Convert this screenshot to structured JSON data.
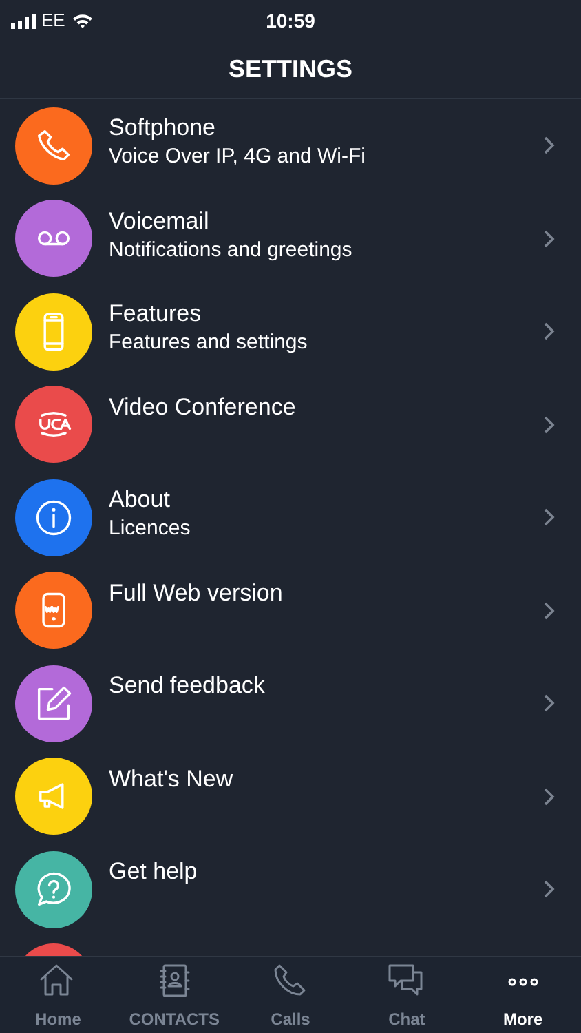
{
  "status_bar": {
    "carrier": "EE",
    "time": "10:59"
  },
  "header": {
    "title": "SETTINGS"
  },
  "items": [
    {
      "title": "Softphone",
      "subtitle": "Voice Over IP, 4G and Wi-Fi",
      "color": "#fb6a1e"
    },
    {
      "title": "Voicemail",
      "subtitle": "Notifications and greetings",
      "color": "#b36ad9"
    },
    {
      "title": "Features",
      "subtitle": "Features and settings",
      "color": "#fcd10f"
    },
    {
      "title": "Video Conference",
      "color": "#ea4b4b"
    },
    {
      "title": "About",
      "subtitle": "Licences",
      "color": "#1e72ee"
    },
    {
      "title": "Full Web version",
      "color": "#fb6a1e"
    },
    {
      "title": "Send feedback",
      "color": "#b36ad9"
    },
    {
      "title": "What's New",
      "color": "#fcd10f"
    },
    {
      "title": "Get help",
      "color": "#46b5a4"
    },
    {
      "color": "#ea4b4b"
    }
  ],
  "tabs": [
    {
      "label": "Home",
      "selected": false
    },
    {
      "label": "CONTACTS",
      "selected": false
    },
    {
      "label": "Calls",
      "selected": false
    },
    {
      "label": "Chat",
      "selected": false
    },
    {
      "label": "More",
      "selected": true
    }
  ]
}
